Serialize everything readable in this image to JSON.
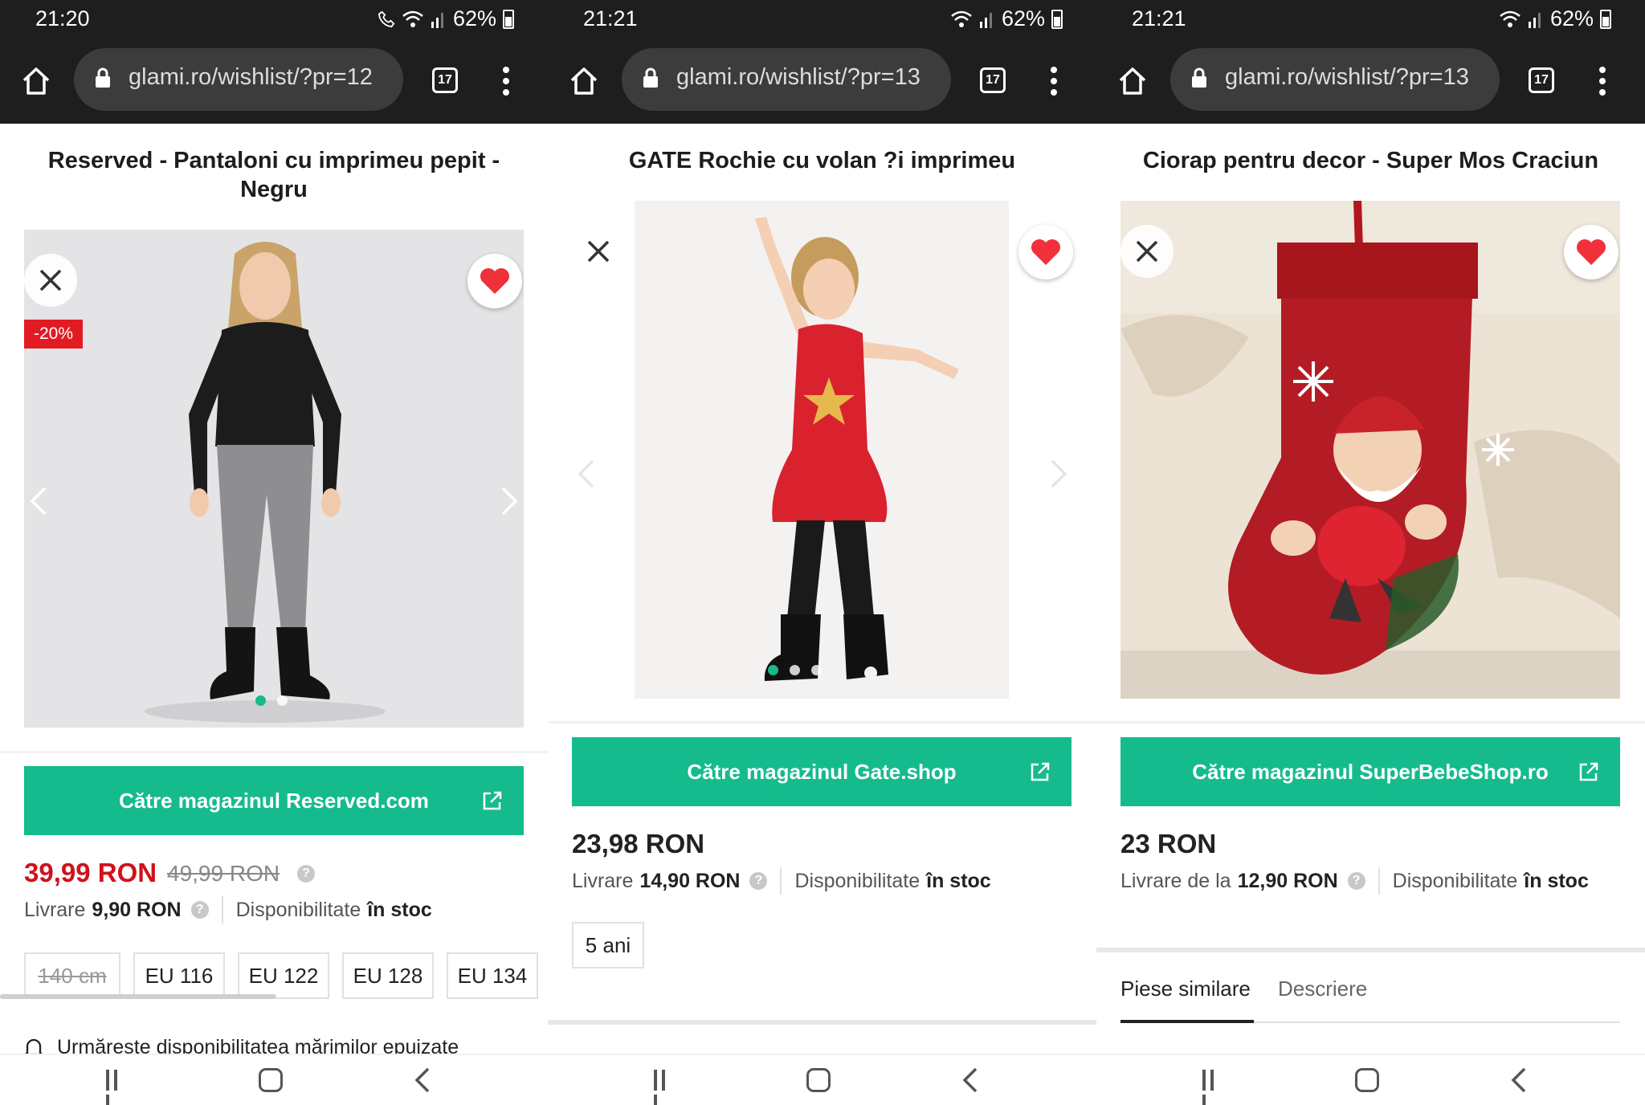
{
  "screens": [
    {
      "status": {
        "time": "21:20",
        "battery": "62%"
      },
      "url": "glami.ro/wishlist/?pr=12",
      "tab_count": "17",
      "title": "Reserved - Pantaloni cu imprimeu pepit - Negru",
      "discount": "-20%",
      "shop_button": "Către magazinul Reserved.com",
      "price": "39,99 RON",
      "old_price": "49,99 RON",
      "delivery_label": "Livrare",
      "delivery_value": "9,90 RON",
      "availability_label": "Disponibilitate",
      "availability_value": "în stoc",
      "sizes": [
        "140 cm",
        "EU 116",
        "EU 122",
        "EU 128",
        "EU 134"
      ],
      "notify": "Urmărește disponibilitatea mărimilor epuizate"
    },
    {
      "status": {
        "time": "21:21",
        "battery": "62%"
      },
      "url": "glami.ro/wishlist/?pr=13",
      "tab_count": "17",
      "title": "GATE Rochie cu volan ?i imprimeu",
      "shop_button": "Către magazinul Gate.shop",
      "price": "23,98 RON",
      "delivery_label": "Livrare",
      "delivery_value": "14,90 RON",
      "availability_label": "Disponibilitate",
      "availability_value": "în stoc",
      "sizes": [
        "5 ani"
      ]
    },
    {
      "status": {
        "time": "21:21",
        "battery": "62%"
      },
      "url": "glami.ro/wishlist/?pr=13",
      "tab_count": "17",
      "title": "Ciorap pentru decor - Super Mos Craciun",
      "shop_button": "Către magazinul SuperBebeShop.ro",
      "price": "23 RON",
      "delivery_label": "Livrare de la",
      "delivery_value": "12,90 RON",
      "availability_label": "Disponibilitate",
      "availability_value": "în stoc",
      "tabs": [
        "Piese similare",
        "Descriere"
      ]
    }
  ],
  "help_glyph": "?",
  "icons": [
    "home-icon",
    "lock-icon",
    "tabs-icon",
    "menu-icon",
    "close-icon",
    "heart-icon",
    "external-link-icon",
    "chevron-left-icon",
    "chevron-right-icon",
    "bell-icon",
    "recent-apps-icon",
    "nav-home-icon",
    "nav-back-icon"
  ],
  "colors": {
    "accent": "#15bb8c",
    "sale": "#d0111b",
    "heart": "#f0313a",
    "dark": "#1e1e1e"
  }
}
